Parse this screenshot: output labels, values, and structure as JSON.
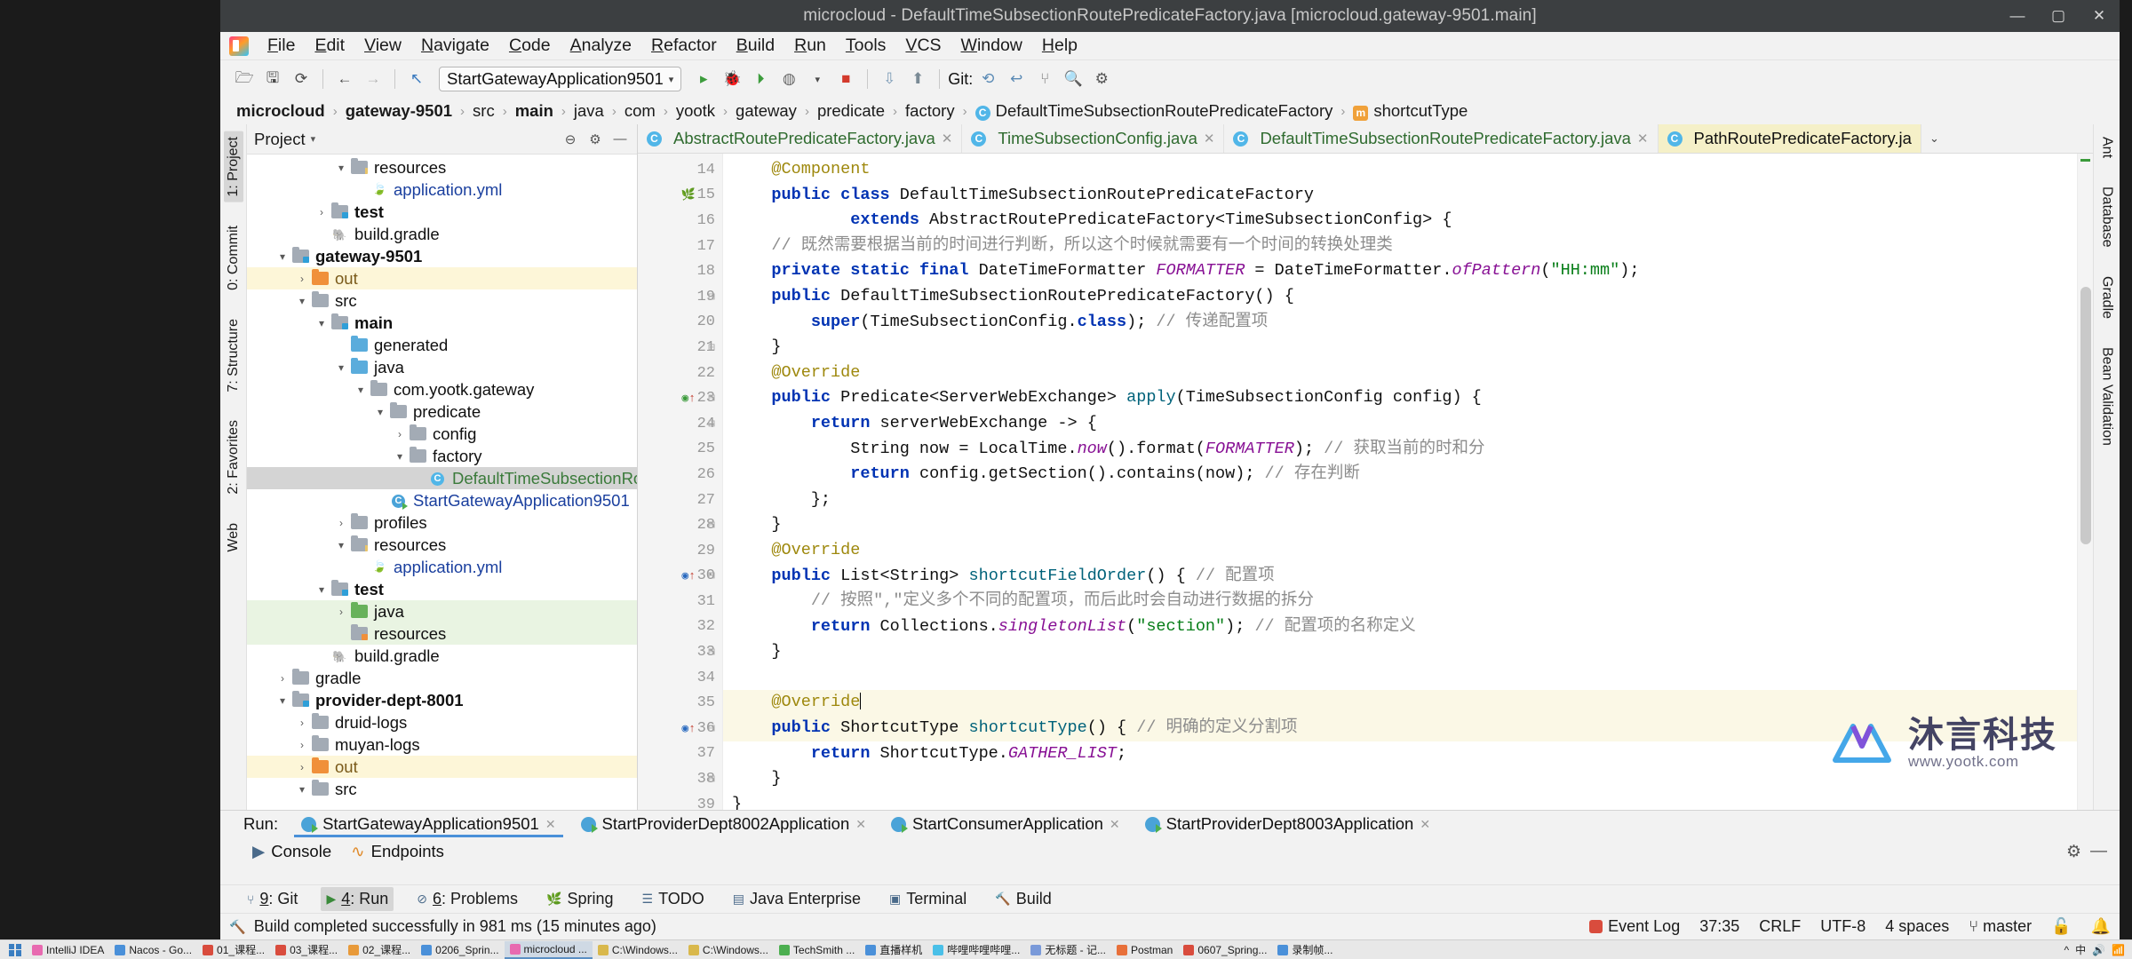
{
  "window": {
    "title": "microcloud - DefaultTimeSubsectionRoutePredicateFactory.java [microcloud.gateway-9501.main]",
    "minimize": "—",
    "maximize": "▢",
    "close": "✕"
  },
  "menubar": {
    "logo": "intellij-logo-icon",
    "items": [
      "File",
      "Edit",
      "View",
      "Navigate",
      "Code",
      "Analyze",
      "Refactor",
      "Build",
      "Run",
      "Tools",
      "VCS",
      "Window",
      "Help"
    ]
  },
  "toolbar": {
    "open_icon": "open-folder-icon",
    "save_icon": "save-icon",
    "sync_icon": "sync-icon",
    "back_icon": "back-arrow-icon",
    "forward_icon": "forward-arrow-icon",
    "undo_icon": "undo-icon",
    "run_config": "StartGatewayApplication9501",
    "run_config_caret": "▾",
    "run_icon": "run-icon",
    "debug_icon": "debug-icon",
    "run_coverage_icon": "run-with-coverage-icon",
    "profile_icon": "profiler-icon",
    "profile_caret": "▾",
    "stop_icon": "stop-icon",
    "update_icon": "update-project-icon",
    "git_label": "Git:",
    "git_commit_icon": "git-commit-icon",
    "git_push_icon": "git-push-icon",
    "git_history_icon": "git-history-icon",
    "git_rollback_icon": "git-rollback-icon",
    "search_icon": "search-icon",
    "settings_icon": "gear-icon"
  },
  "breadcrumb": [
    {
      "label": "microcloud",
      "bold": true,
      "chip": null
    },
    {
      "label": "gateway-9501",
      "bold": true,
      "chip": null
    },
    {
      "label": "src",
      "bold": false,
      "chip": null
    },
    {
      "label": "main",
      "bold": true,
      "chip": null
    },
    {
      "label": "java",
      "bold": false,
      "chip": null
    },
    {
      "label": "com",
      "bold": false,
      "chip": null
    },
    {
      "label": "yootk",
      "bold": false,
      "chip": null
    },
    {
      "label": "gateway",
      "bold": false,
      "chip": null
    },
    {
      "label": "predicate",
      "bold": false,
      "chip": null
    },
    {
      "label": "factory",
      "bold": false,
      "chip": null
    },
    {
      "label": "DefaultTimeSubsectionRoutePredicateFactory",
      "bold": false,
      "chip": "C"
    },
    {
      "label": "shortcutType",
      "bold": false,
      "chip": "m"
    }
  ],
  "left_strip": {
    "tabs": [
      {
        "label": "1: Project",
        "selected": true
      },
      {
        "label": "0: Commit",
        "selected": false
      },
      {
        "label": "7: Structure",
        "selected": false
      },
      {
        "label": "2: Favorites",
        "selected": false
      },
      {
        "label": "Web",
        "selected": false
      }
    ]
  },
  "right_strip": {
    "tabs": [
      {
        "label": "Ant"
      },
      {
        "label": "Database"
      },
      {
        "label": "Gradle"
      },
      {
        "label": "Bean Validation"
      }
    ]
  },
  "project_panel": {
    "title": "Project",
    "caret": "▾",
    "icons": [
      "collapse-all-icon",
      "settings-icon",
      "hide-icon"
    ],
    "tree": [
      {
        "depth": 4,
        "arrow": "▾",
        "icon": "folder-resources",
        "label": "resources",
        "bold": false,
        "color": "",
        "hl": ""
      },
      {
        "depth": 5,
        "arrow": "",
        "icon": "yml-file",
        "label": "application.yml",
        "bold": false,
        "color": "blue",
        "hl": ""
      },
      {
        "depth": 3,
        "arrow": "›",
        "icon": "folder-test",
        "label": "test",
        "bold": true,
        "color": "",
        "hl": ""
      },
      {
        "depth": 3,
        "arrow": "",
        "icon": "gradle-file",
        "label": "build.gradle",
        "bold": false,
        "color": "",
        "hl": ""
      },
      {
        "depth": 1,
        "arrow": "▾",
        "icon": "folder-module",
        "label": "gateway-9501",
        "bold": true,
        "color": "",
        "hl": ""
      },
      {
        "depth": 2,
        "arrow": "›",
        "icon": "folder-out",
        "label": "out",
        "bold": false,
        "color": "orange",
        "hl": "yellow"
      },
      {
        "depth": 2,
        "arrow": "▾",
        "icon": "folder-gray",
        "label": "src",
        "bold": false,
        "color": "",
        "hl": ""
      },
      {
        "depth": 3,
        "arrow": "▾",
        "icon": "folder-main",
        "label": "main",
        "bold": true,
        "color": "",
        "hl": ""
      },
      {
        "depth": 4,
        "arrow": "",
        "icon": "folder-generated",
        "label": "generated",
        "bold": false,
        "color": "",
        "hl": ""
      },
      {
        "depth": 4,
        "arrow": "▾",
        "icon": "folder-java",
        "label": "java",
        "bold": false,
        "color": "",
        "hl": ""
      },
      {
        "depth": 5,
        "arrow": "▾",
        "icon": "folder-package",
        "label": "com.yootk.gateway",
        "bold": false,
        "color": "",
        "hl": ""
      },
      {
        "depth": 6,
        "arrow": "▾",
        "icon": "folder-package",
        "label": "predicate",
        "bold": false,
        "color": "",
        "hl": ""
      },
      {
        "depth": 7,
        "arrow": "›",
        "icon": "folder-package",
        "label": "config",
        "bold": false,
        "color": "",
        "hl": ""
      },
      {
        "depth": 7,
        "arrow": "▾",
        "icon": "folder-package",
        "label": "factory",
        "bold": false,
        "color": "",
        "hl": ""
      },
      {
        "depth": 8,
        "arrow": "",
        "icon": "java-class",
        "label": "DefaultTimeSubsectionRoutePredica",
        "bold": false,
        "color": "green",
        "hl": "sel"
      },
      {
        "depth": 6,
        "arrow": "",
        "icon": "java-class-run",
        "label": "StartGatewayApplication9501",
        "bold": false,
        "color": "blue",
        "hl": ""
      },
      {
        "depth": 4,
        "arrow": "›",
        "icon": "folder-gray",
        "label": "profiles",
        "bold": false,
        "color": "",
        "hl": ""
      },
      {
        "depth": 4,
        "arrow": "▾",
        "icon": "folder-resources",
        "label": "resources",
        "bold": false,
        "color": "",
        "hl": ""
      },
      {
        "depth": 5,
        "arrow": "",
        "icon": "yml-file",
        "label": "application.yml",
        "bold": false,
        "color": "blue",
        "hl": ""
      },
      {
        "depth": 3,
        "arrow": "▾",
        "icon": "folder-test",
        "label": "test",
        "bold": true,
        "color": "",
        "hl": ""
      },
      {
        "depth": 4,
        "arrow": "›",
        "icon": "folder-java-green",
        "label": "java",
        "bold": false,
        "color": "",
        "hl": "green"
      },
      {
        "depth": 4,
        "arrow": "",
        "icon": "folder-resources-test",
        "label": "resources",
        "bold": false,
        "color": "",
        "hl": "green"
      },
      {
        "depth": 3,
        "arrow": "",
        "icon": "gradle-file",
        "label": "build.gradle",
        "bold": false,
        "color": "",
        "hl": ""
      },
      {
        "depth": 1,
        "arrow": "›",
        "icon": "folder-gray",
        "label": "gradle",
        "bold": false,
        "color": "",
        "hl": ""
      },
      {
        "depth": 1,
        "arrow": "▾",
        "icon": "folder-module",
        "label": "provider-dept-8001",
        "bold": true,
        "color": "",
        "hl": ""
      },
      {
        "depth": 2,
        "arrow": "›",
        "icon": "folder-gray",
        "label": "druid-logs",
        "bold": false,
        "color": "",
        "hl": ""
      },
      {
        "depth": 2,
        "arrow": "›",
        "icon": "folder-gray",
        "label": "muyan-logs",
        "bold": false,
        "color": "",
        "hl": ""
      },
      {
        "depth": 2,
        "arrow": "›",
        "icon": "folder-out",
        "label": "out",
        "bold": false,
        "color": "orange",
        "hl": "yellow"
      },
      {
        "depth": 2,
        "arrow": "▾",
        "icon": "folder-gray",
        "label": "src",
        "bold": false,
        "color": "",
        "hl": ""
      }
    ]
  },
  "editor_tabs": [
    {
      "label": "AbstractRoutePredicateFactory.java",
      "active": false,
      "chip": "C",
      "close": "✕"
    },
    {
      "label": "TimeSubsectionConfig.java",
      "active": false,
      "chip": "C",
      "close": "✕"
    },
    {
      "label": "DefaultTimeSubsectionRoutePredicateFactory.java",
      "active": false,
      "chip": "C",
      "close": "✕"
    },
    {
      "label": "PathRoutePredicateFactory.ja",
      "active": true,
      "chip": "C",
      "close": ""
    }
  ],
  "editor_tabs_more": "⌄",
  "code": {
    "first_line": 14,
    "lines": [
      {
        "n": 14,
        "html": "    <span class='an'>@Component</span>",
        "mark": "",
        "fold": "",
        "hl": false
      },
      {
        "n": 15,
        "html": "    <span class='kw'>public class</span> DefaultTimeSubsectionRoutePredicateFactory",
        "mark": "spring",
        "fold": "",
        "hl": false
      },
      {
        "n": 16,
        "html": "            <span class='kw'>extends</span> AbstractRoutePredicateFactory&lt;TimeSubsectionConfig&gt; {",
        "mark": "",
        "fold": "",
        "hl": false
      },
      {
        "n": 17,
        "html": "    <span class='cm'>// 既然需要根据当前的时间进行判断，所以这个时候就需要有一个时间的转换处理类</span>",
        "mark": "",
        "fold": "",
        "hl": false
      },
      {
        "n": 18,
        "html": "    <span class='kw'>private static final</span> DateTimeFormatter <span class='fld'>FORMATTER</span> = DateTimeFormatter.<span class='fld'>ofPattern</span>(<span class='st'>\"HH:mm\"</span>);",
        "mark": "",
        "fold": "",
        "hl": false
      },
      {
        "n": 19,
        "html": "    <span class='kw'>public</span> DefaultTimeSubsectionRoutePredicateFactory() {",
        "mark": "",
        "fold": "minus",
        "hl": false
      },
      {
        "n": 20,
        "html": "        <span class='kw'>super</span>(TimeSubsectionConfig.<span class='kw'>class</span>); <span class='cm'>// 传递配置项</span>",
        "mark": "",
        "fold": "",
        "hl": false
      },
      {
        "n": 21,
        "html": "    }",
        "mark": "",
        "fold": "minus",
        "hl": false
      },
      {
        "n": 22,
        "html": "    <span class='an'>@Override</span>",
        "mark": "",
        "fold": "",
        "hl": false
      },
      {
        "n": 23,
        "html": "    <span class='kw'>public</span> Predicate&lt;ServerWebExchange&gt; <span class='mth'>apply</span>(TimeSubsectionConfig config) {",
        "mark": "override-green",
        "fold": "minus",
        "hl": false
      },
      {
        "n": 24,
        "html": "        <span class='kw'>return</span> serverWebExchange -&gt; {",
        "mark": "",
        "fold": "minus",
        "hl": false
      },
      {
        "n": 25,
        "html": "            String now = LocalTime.<span class='fld'>now</span>().format(<span class='fld'>FORMATTER</span>); <span class='cm'>// 获取当前的时和分</span>",
        "mark": "",
        "fold": "",
        "hl": false
      },
      {
        "n": 26,
        "html": "            <span class='kw'>return</span> config.getSection().contains(now); <span class='cm'>// 存在判断</span>",
        "mark": "",
        "fold": "",
        "hl": false
      },
      {
        "n": 27,
        "html": "        };",
        "mark": "",
        "fold": "",
        "hl": false
      },
      {
        "n": 28,
        "html": "    }",
        "mark": "",
        "fold": "minus",
        "hl": false
      },
      {
        "n": 29,
        "html": "    <span class='an'>@Override</span>",
        "mark": "",
        "fold": "",
        "hl": false
      },
      {
        "n": 30,
        "html": "    <span class='kw'>public</span> List&lt;String&gt; <span class='mth'>shortcutFieldOrder</span>() { <span class='cm'>// 配置项</span>",
        "mark": "override-blue",
        "fold": "minus",
        "hl": false
      },
      {
        "n": 31,
        "html": "        <span class='cm'>// 按照\",\"定义多个不同的配置项，而后此时会自动进行数据的拆分</span>",
        "mark": "",
        "fold": "",
        "hl": false
      },
      {
        "n": 32,
        "html": "        <span class='kw'>return</span> Collections.<span class='fld'>singletonList</span>(<span class='st'>\"section\"</span>); <span class='cm'>// 配置项的名称定义</span>",
        "mark": "",
        "fold": "",
        "hl": false
      },
      {
        "n": 33,
        "html": "    }",
        "mark": "",
        "fold": "minus",
        "hl": false
      },
      {
        "n": 34,
        "html": "",
        "mark": "",
        "fold": "",
        "hl": false
      },
      {
        "n": 35,
        "html": "    <span class='an'>@Override</span><span class='caret-bar'></span>",
        "mark": "",
        "fold": "",
        "hl": true
      },
      {
        "n": 36,
        "html": "    <span class='kw'>public</span> ShortcutType <span class='mth'>shortcutType</span>() { <span class='cm'>// 明确的定义分割项</span>",
        "mark": "override-blue",
        "fold": "minus",
        "hl": true
      },
      {
        "n": 37,
        "html": "        <span class='kw'>return</span> ShortcutType.<span class='fld'>GATHER_LIST</span>;",
        "mark": "",
        "fold": "",
        "hl": false
      },
      {
        "n": 38,
        "html": "    }",
        "mark": "",
        "fold": "minus",
        "hl": false
      },
      {
        "n": 39,
        "html": "}",
        "mark": "",
        "fold": "",
        "hl": false
      },
      {
        "n": 40,
        "html": "",
        "mark": "",
        "fold": "",
        "hl": false
      }
    ]
  },
  "watermark": {
    "cn": "沐言科技",
    "url": "www.yootk.com"
  },
  "run_window": {
    "run_label": "Run:",
    "tabs": [
      {
        "label": "StartGatewayApplication9501",
        "active": true,
        "close": "✕"
      },
      {
        "label": "StartProviderDept8002Application",
        "active": false,
        "close": "✕"
      },
      {
        "label": "StartConsumerApplication",
        "active": false,
        "close": "✕"
      },
      {
        "label": "StartProviderDept8003Application",
        "active": false,
        "close": "✕"
      }
    ],
    "subtabs": [
      {
        "label": "Console",
        "icon": "console-icon"
      },
      {
        "label": "Endpoints",
        "icon": "endpoints-icon"
      }
    ],
    "settings_icon": "gear-icon",
    "hide_icon": "minimize-icon"
  },
  "bottom_strip": [
    {
      "label": "9: Git",
      "icon": "git-icon",
      "selected": false
    },
    {
      "label": "4: Run",
      "icon": "run-icon",
      "selected": true
    },
    {
      "label": "6: Problems",
      "icon": "problems-icon",
      "selected": false
    },
    {
      "label": "Spring",
      "icon": "spring-icon",
      "selected": false
    },
    {
      "label": "TODO",
      "icon": "todo-icon",
      "selected": false
    },
    {
      "label": "Java Enterprise",
      "icon": "java-enterprise-icon",
      "selected": false
    },
    {
      "label": "Terminal",
      "icon": "terminal-icon",
      "selected": false
    },
    {
      "label": "Build",
      "icon": "build-icon",
      "selected": false
    }
  ],
  "status_bar": {
    "build_icon": "hammer-icon",
    "message": "Build completed successfully in 981 ms (15 minutes ago)",
    "caret_position": "37:35",
    "line_separator": "CRLF",
    "encoding": "UTF-8",
    "indent": "4 spaces",
    "branch_icon": "git-branch-icon",
    "branch": "master",
    "lock_icon": "lock-icon",
    "notify_icon": "notification-icon",
    "event_log": "Event Log",
    "event_icon": "event-log-icon"
  },
  "taskbar": {
    "start_icon": "windows-start-icon",
    "items": [
      {
        "label": "IntelliJ IDEA",
        "color": "#e86ab0",
        "active": false
      },
      {
        "label": "Nacos - Go...",
        "color": "#4a90d9",
        "active": false
      },
      {
        "label": "01_课程...",
        "color": "#d94c3d",
        "active": false
      },
      {
        "label": "03_课程...",
        "color": "#d94c3d",
        "active": false
      },
      {
        "label": "02_课程...",
        "color": "#e89a3a",
        "active": false
      },
      {
        "label": "0206_Sprin...",
        "color": "#4a90d9",
        "active": false
      },
      {
        "label": "microcloud ...",
        "color": "#e86ab0",
        "active": true
      },
      {
        "label": "C:\\Windows...",
        "color": "#d9b84c",
        "active": false
      },
      {
        "label": "C:\\Windows...",
        "color": "#d9b84c",
        "active": false
      },
      {
        "label": "TechSmith ...",
        "color": "#4caf50",
        "active": false
      },
      {
        "label": "直播样机",
        "color": "#4a90d9",
        "active": false
      },
      {
        "label": "哔哩哔哩哔哩...",
        "color": "#4ac0e8",
        "active": false
      },
      {
        "label": "无标题 - 记...",
        "color": "#7a9ad9",
        "active": false
      },
      {
        "label": "Postman",
        "color": "#e8703a",
        "active": false
      },
      {
        "label": "0607_Spring...",
        "color": "#d94c3d",
        "active": false
      },
      {
        "label": "录制帧...",
        "color": "#4a90d9",
        "active": false
      }
    ],
    "tray": [
      "^",
      "中",
      "🔊",
      "📶"
    ]
  }
}
